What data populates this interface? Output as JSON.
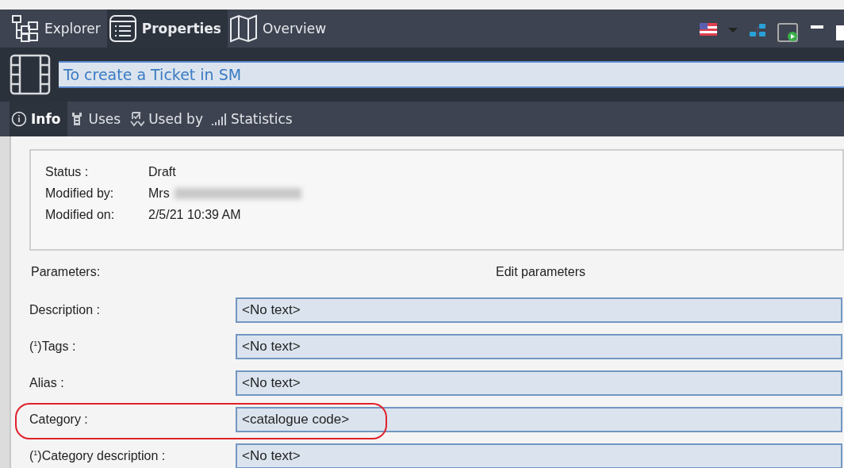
{
  "main_tabs": [
    {
      "label": "Explorer",
      "kind": "explorer",
      "selected": false
    },
    {
      "label": "Properties",
      "kind": "properties",
      "selected": true
    },
    {
      "label": "Overview",
      "kind": "overview",
      "selected": false
    }
  ],
  "title_field": {
    "value": "To create a Ticket in SM"
  },
  "sub_tabs": [
    {
      "label": "Info",
      "kind": "info",
      "selected": true
    },
    {
      "label": "Uses",
      "kind": "uses",
      "selected": false
    },
    {
      "label": "Used by",
      "kind": "usedby",
      "selected": false
    },
    {
      "label": "Statistics",
      "kind": "stats",
      "selected": false
    }
  ],
  "info": [
    {
      "label": "Status :",
      "value": "Draft",
      "redacted": false
    },
    {
      "label": "Modified by:",
      "value": "Mrs",
      "redacted": true
    },
    {
      "label": "Modified on:",
      "value": "2/5/21 10:39 AM",
      "redacted": false
    }
  ],
  "parameters_label": "Parameters:",
  "edit_parameters_label": "Edit parameters",
  "parameters": [
    {
      "label": "Description :",
      "value": "<No text>",
      "highlighted": false
    },
    {
      "label": "($^{1}$)Tags :",
      "value": "<No text>",
      "highlighted": false
    },
    {
      "label": "Alias :",
      "value": "<No text>",
      "highlighted": false
    },
    {
      "label": "Category :",
      "value": "<catalogue code>",
      "highlighted": true
    },
    {
      "label": "($^{1}$)Category description :",
      "value": "<No text>",
      "highlighted": false
    }
  ]
}
